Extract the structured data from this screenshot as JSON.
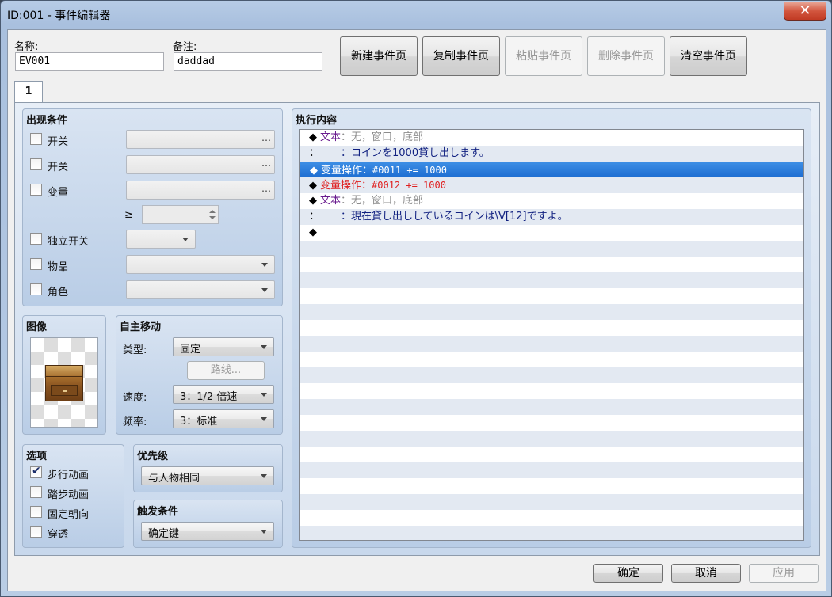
{
  "window": {
    "title": "ID:001 - 事件编辑器",
    "close_glyph": "✕"
  },
  "header": {
    "name_label": "名称:",
    "name_value": "EV001",
    "note_label": "备注:",
    "note_value": "daddad"
  },
  "toolbar": {
    "new_page": "新建事件页",
    "copy_page": "复制事件页",
    "paste_page": "粘贴事件页",
    "delete_page": "删除事件页",
    "clear_page": "清空事件页"
  },
  "tabs": [
    {
      "label": "1"
    }
  ],
  "conditions": {
    "title": "出现条件",
    "switch1": "开关",
    "switch2": "开关",
    "variable": "变量",
    "ge_symbol": "≥",
    "self_switch": "独立开关",
    "item": "物品",
    "actor": "角色",
    "dots": "…"
  },
  "image": {
    "title": "图像"
  },
  "autonomous": {
    "title": "自主移动",
    "type_label": "类型:",
    "type_value": "固定",
    "route_button": "路线...",
    "speed_label": "速度:",
    "speed_value": "3：1/2 倍速",
    "freq_label": "频率:",
    "freq_value": "3：标准"
  },
  "options": {
    "title": "选项",
    "items": [
      {
        "label": "步行动画",
        "checked": true
      },
      {
        "label": "踏步动画",
        "checked": false
      },
      {
        "label": "固定朝向",
        "checked": false
      },
      {
        "label": "穿透",
        "checked": false
      }
    ]
  },
  "priority": {
    "title": "优先级",
    "value": "与人物相同"
  },
  "trigger": {
    "title": "触发条件",
    "value": "确定键"
  },
  "contents": {
    "title": "执行内容",
    "rows": [
      {
        "diamond": "◆",
        "cmd": "文本",
        "sep": "：",
        "args": "无，窗口，底部",
        "style": "text"
      },
      {
        "diamond": "：",
        "cmd": "",
        "sep": "　　：",
        "args": "コインを1000貸し出します。",
        "style": "textcont"
      },
      {
        "diamond": "◆",
        "cmd": "变量操作",
        "sep": "：",
        "args": "#0011 += 1000",
        "style": "selected"
      },
      {
        "diamond": "◆",
        "cmd": "变量操作",
        "sep": "：",
        "args": "#0012 += 1000",
        "style": "red"
      },
      {
        "diamond": "◆",
        "cmd": "文本",
        "sep": "：",
        "args": "无，窗口，底部",
        "style": "text"
      },
      {
        "diamond": "：",
        "cmd": "",
        "sep": "　　：",
        "args": "現在貸し出ししているコインは\\V[12]ですよ。",
        "style": "textcont"
      },
      {
        "diamond": "◆",
        "cmd": "",
        "sep": "",
        "args": "",
        "style": "empty"
      }
    ]
  },
  "footer": {
    "ok": "确定",
    "cancel": "取消",
    "apply": "应用"
  }
}
